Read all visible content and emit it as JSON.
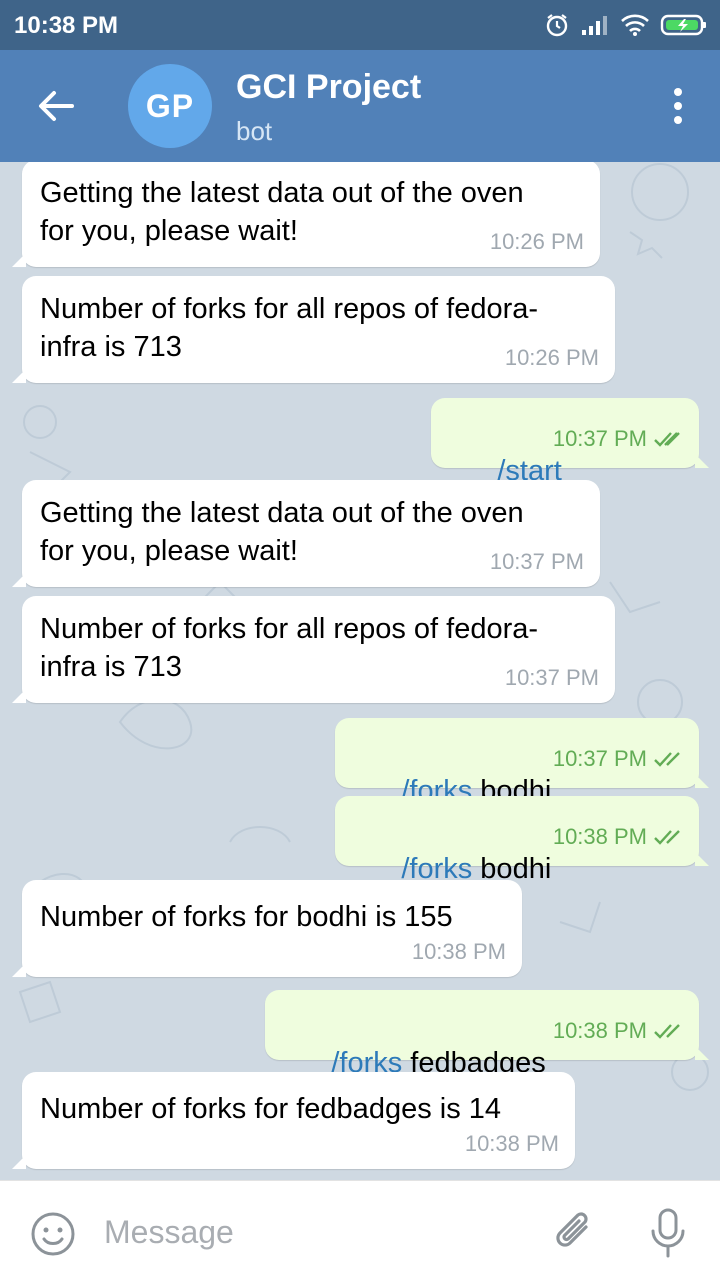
{
  "status_bar": {
    "time": "10:38 PM"
  },
  "header": {
    "avatar_initials": "GP",
    "title": "GCI Project",
    "subtitle": "bot"
  },
  "messages": [
    {
      "direction": "in",
      "text": "Getting the latest data out of the oven\nfor you, please wait!",
      "time": "10:26 PM"
    },
    {
      "direction": "in",
      "text": "Number of forks for all repos of fedora-\ninfra is 713",
      "time": "10:26 PM"
    },
    {
      "direction": "out",
      "command": "/start",
      "arg": "",
      "time": "10:37 PM",
      "status": "read"
    },
    {
      "direction": "in",
      "text": "Getting the latest data out of the oven\nfor you, please wait!",
      "time": "10:37 PM"
    },
    {
      "direction": "in",
      "text": "Number of forks for all repos of fedora-\ninfra is 713",
      "time": "10:37 PM"
    },
    {
      "direction": "out",
      "command": "/forks",
      "arg": " bodhi",
      "time": "10:37 PM",
      "status": "read"
    },
    {
      "direction": "out",
      "command": "/forks",
      "arg": " bodhi",
      "time": "10:38 PM",
      "status": "read"
    },
    {
      "direction": "in",
      "text": "Number of forks for bodhi is 155",
      "time": "10:38 PM"
    },
    {
      "direction": "out",
      "command": "/forks",
      "arg": " fedbadges",
      "time": "10:38 PM",
      "status": "read"
    },
    {
      "direction": "in",
      "text": "Number of forks for fedbadges is 14",
      "time": "10:38 PM"
    }
  ],
  "composer": {
    "placeholder": "Message"
  },
  "colors": {
    "header": "#5181b8",
    "status_bar": "#3f6489",
    "outgoing_bubble": "#effdde",
    "incoming_bubble": "#ffffff",
    "command_link": "#2d7ab9",
    "read_check": "#62ac55"
  },
  "icons": {
    "back": "arrow-left-icon",
    "menu": "more-vertical-icon",
    "emoji": "smile-icon",
    "attach": "paperclip-icon",
    "mic": "microphone-icon"
  }
}
